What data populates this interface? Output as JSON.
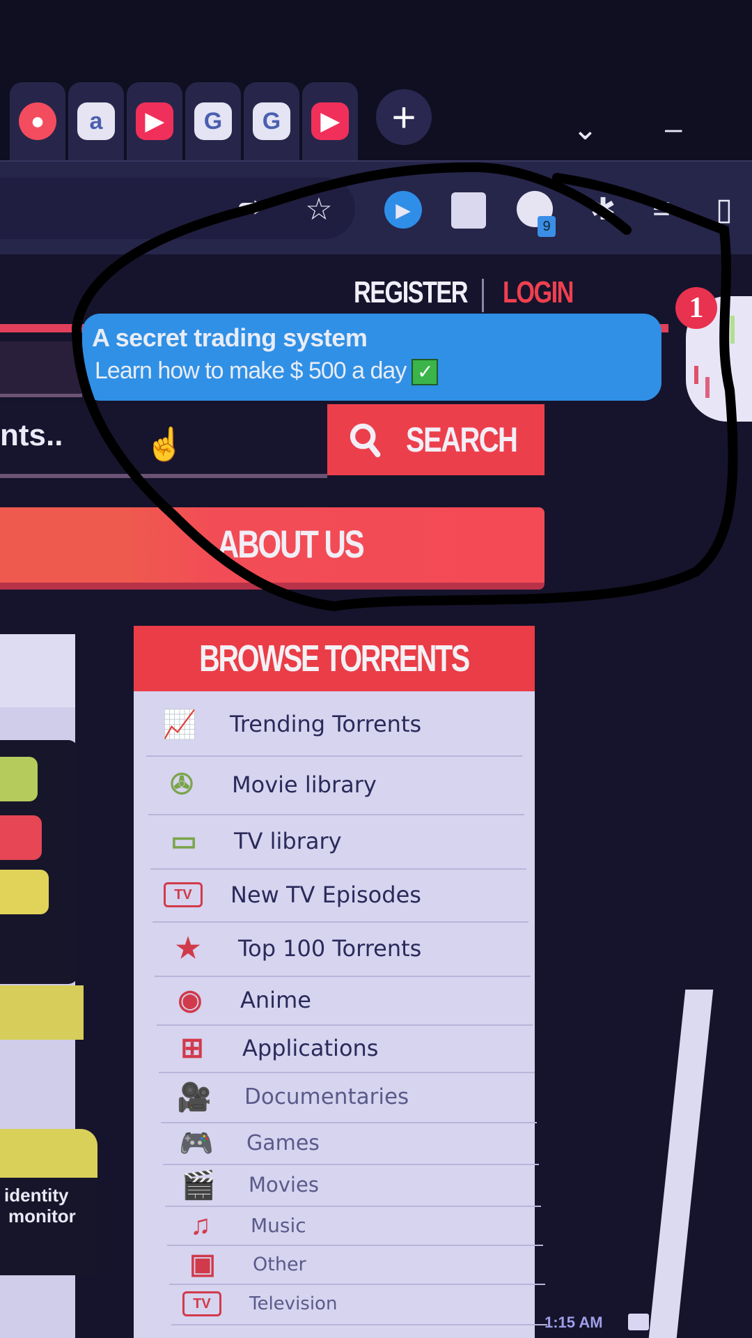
{
  "browser": {
    "tabs": [
      {
        "icon": "reddit-icon",
        "color": "#f24c5e",
        "glyph": "●"
      },
      {
        "icon": "amazon-icon",
        "color": "#e6e4f2",
        "glyph": "a"
      },
      {
        "icon": "youtube-icon",
        "color": "#f0305a",
        "glyph": "▶"
      },
      {
        "icon": "google-icon",
        "color": "#e4e4f4",
        "glyph": "G"
      },
      {
        "icon": "google-icon",
        "color": "#e4e4f4",
        "glyph": "G"
      },
      {
        "icon": "youtube-icon",
        "color": "#f0305a",
        "glyph": "▶"
      }
    ],
    "new_tab": "+",
    "tab_search": "⌄",
    "minimize": "–",
    "toolbar": {
      "share": "⮫",
      "bookmark": "☆",
      "extension_badge": "9",
      "puzzle": "✱",
      "media": "≡",
      "window": "▯"
    }
  },
  "header": {
    "register": "REGISTER",
    "login": "LOGIN",
    "notification_count": "1"
  },
  "ad_banner": {
    "title": "A secret trading system",
    "subtitle": "Learn how to make $ 500 a day",
    "check": "✓"
  },
  "search": {
    "placeholder_partial": "nts..",
    "button_label": "SEARCH"
  },
  "nav": {
    "about_label": "ABOUT US"
  },
  "browse": {
    "title": "BROWSE TORRENTS",
    "items": [
      {
        "label": "Trending Torrents",
        "icon": "chart-icon",
        "glyph": "📈",
        "color": "#7aa44a"
      },
      {
        "label": "Movie library",
        "icon": "film-reel-icon",
        "glyph": "✇",
        "color": "#7aa44a"
      },
      {
        "label": "TV library",
        "icon": "cassette-icon",
        "glyph": "▭",
        "color": "#7aa44a"
      },
      {
        "label": "New TV Episodes",
        "icon": "tv-icon",
        "glyph": "TV",
        "color": "#d13a4a"
      },
      {
        "label": "Top 100 Torrents",
        "icon": "top-star-icon",
        "glyph": "★",
        "color": "#d13a4a"
      },
      {
        "label": "Anime",
        "icon": "anime-icon",
        "glyph": "◉",
        "color": "#d13a4a"
      },
      {
        "label": "Applications",
        "icon": "windows-icon",
        "glyph": "⊞",
        "color": "#d13a4a"
      },
      {
        "label": "Documentaries",
        "icon": "camera-icon",
        "glyph": "🎥",
        "color": "#d13a4a"
      },
      {
        "label": "Games",
        "icon": "gamepad-icon",
        "glyph": "🎮",
        "color": "#d13a4a"
      },
      {
        "label": "Movies",
        "icon": "clapper-icon",
        "glyph": "🎬",
        "color": "#d13a4a"
      },
      {
        "label": "Music",
        "icon": "music-icon",
        "glyph": "♫",
        "color": "#d13a4a"
      },
      {
        "label": "Other",
        "icon": "box-icon",
        "glyph": "▣",
        "color": "#d13a4a"
      },
      {
        "label": "Television",
        "icon": "television-icon",
        "glyph": "TV",
        "color": "#d13a4a"
      }
    ]
  },
  "left_panel": {
    "text_line1": "identity",
    "text_line2": "monitor"
  },
  "taskbar": {
    "time": "1:15 AM"
  }
}
